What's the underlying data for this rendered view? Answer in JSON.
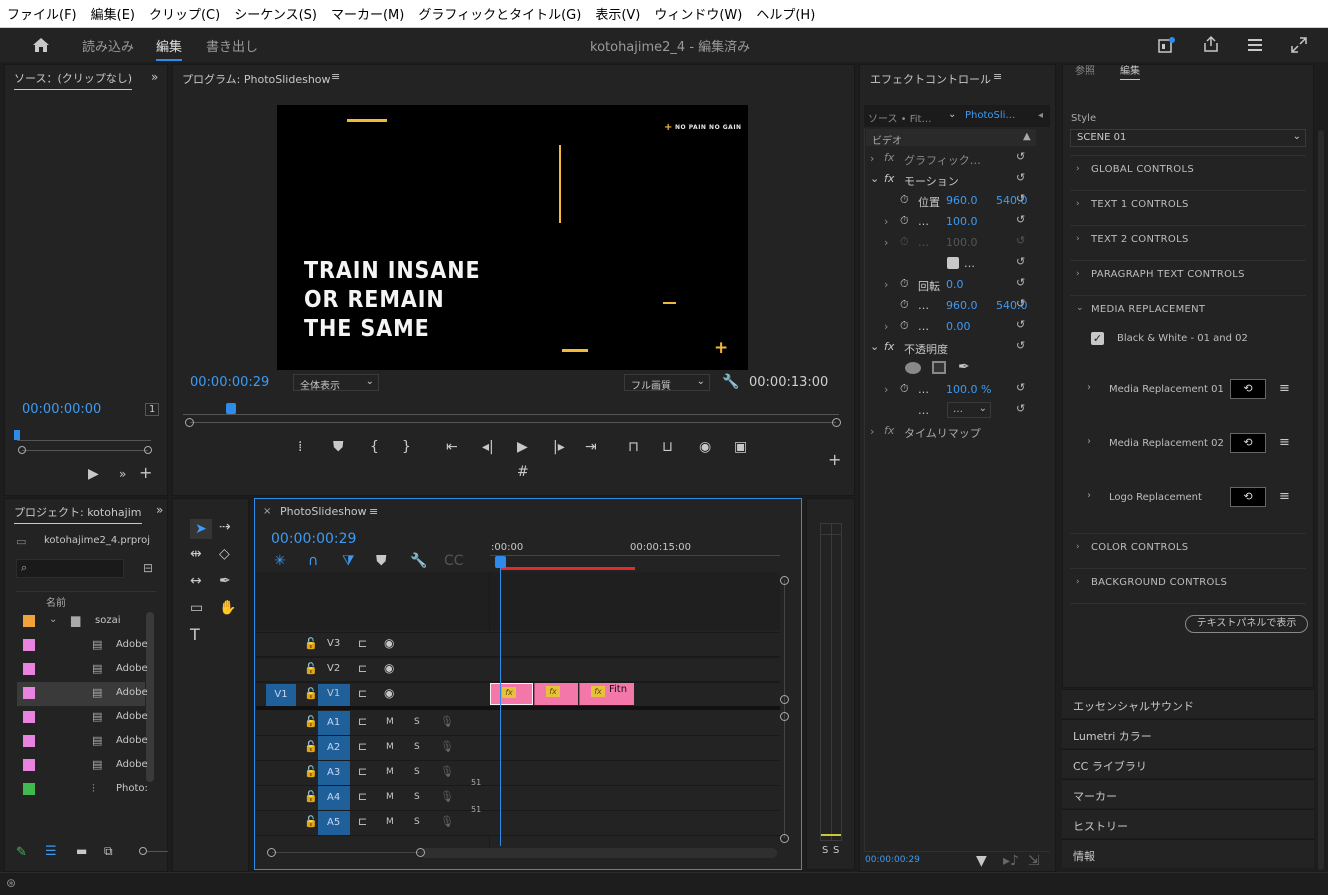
{
  "menu": [
    "ファイル(F)",
    "編集(E)",
    "クリップ(C)",
    "シーケンス(S)",
    "マーカー(M)",
    "グラフィックとタイトル(G)",
    "表示(V)",
    "ウィンドウ(W)",
    "ヘルプ(H)"
  ],
  "header": {
    "tabs": [
      "読み込み",
      "編集",
      "書き出し"
    ],
    "active_tab": "編集",
    "doc_title": "kotohajime2_4 - 編集済み"
  },
  "source": {
    "title": "ソース：(クリップなし)",
    "timecode": "00:00:00:00",
    "page": "1"
  },
  "program": {
    "title": "プログラム: PhotoSlideshow",
    "timecode_current": "00:00:00:29",
    "timecode_duration": "00:00:13:00",
    "fit_select": "全体表示",
    "quality_select": "フル画質",
    "preview_text_lines": [
      "TRAIN INSANE",
      "OR REMAIN",
      "THE SAME"
    ],
    "preview_badge": "NO PAIN NO GAIN"
  },
  "effects": {
    "title": "エフェクトコントロール",
    "source_tab": "ソース • Fit…",
    "program_tab": "PhotoSli…",
    "section_video": "ビデオ",
    "graphic": "グラフィック…",
    "motion": "モーション",
    "position_label": "位置",
    "position_x": "960.0",
    "position_y": "540.0",
    "scale": "100.0",
    "scale_width": "100.0",
    "rotation_label": "回転",
    "rotation": "0.0",
    "anchor_x": "960.0",
    "anchor_y": "540.0",
    "flicker": "0.00",
    "opacity_label": "不透明度",
    "opacity": "100.0 %",
    "blend": "…",
    "time_remap": "タイムリマップ",
    "timecode": "00:00:00:29"
  },
  "graphics": {
    "tab1": "参照",
    "tab2": "編集",
    "style_label": "Style",
    "style_value": "SCENE 01",
    "sections_top": [
      "GLOBAL CONTROLS",
      "TEXT 1 CONTROLS",
      "TEXT 2 CONTROLS",
      "PARAGRAPH TEXT CONTROLS"
    ],
    "media_section": "MEDIA REPLACEMENT",
    "checkbox_label": "Black & White - 01 and 02",
    "media_items": [
      "Media Replacement 01",
      "Media Replacement 02",
      "Logo Replacement"
    ],
    "sections_bottom": [
      "COLOR CONTROLS",
      "BACKGROUND CONTROLS"
    ],
    "text_panel_button": "テキストパネルで表示"
  },
  "side_panels": [
    "エッセンシャルサウンド",
    "Lumetri カラー",
    "CC ライブラリ",
    "マーカー",
    "ヒストリー",
    "情報"
  ],
  "project": {
    "title": "プロジェクト: kotohajim",
    "file": "kotohajime2_4.prproj",
    "col_name": "名前",
    "folder": "sozai",
    "items": [
      {
        "name": "Adobe",
        "color": "#e884e0"
      },
      {
        "name": "Adobe",
        "color": "#e884e0"
      },
      {
        "name": "Adobe",
        "color": "#e884e0"
      },
      {
        "name": "Adobe",
        "color": "#e884e0"
      },
      {
        "name": "Adobe",
        "color": "#e884e0"
      },
      {
        "name": "Adobe",
        "color": "#e884e0"
      },
      {
        "name": "Photo:",
        "color": "#3fb950"
      }
    ]
  },
  "timeline": {
    "title": "PhotoSlideshow",
    "timecode": "00:00:00:29",
    "ruler": [
      ":00:00",
      "00:00:15:00"
    ],
    "video_tracks": [
      "V3",
      "V2",
      "V1"
    ],
    "source_patch": "V1",
    "audio_tracks": [
      "A1",
      "A2",
      "A3",
      "A4",
      "A5"
    ],
    "mute": "M",
    "solo": "S",
    "channel_label": "51",
    "clip_label": "Fitn"
  },
  "meter": {
    "left": "S",
    "right": "S"
  },
  "colors": {
    "accent": "#2d8ceb",
    "timecode": "#3d9bf3",
    "preview_yellow": "#f2b93b",
    "clip_pink": "#f378a9",
    "folder_orange": "#f0a33a"
  }
}
